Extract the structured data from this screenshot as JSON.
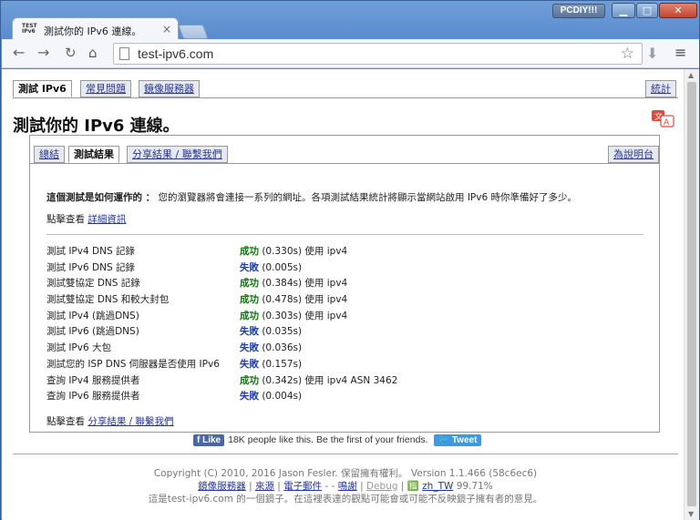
{
  "window": {
    "profile_label": "PCDIY!!!",
    "minimize_glyph": "▁",
    "maximize_glyph": "□",
    "close_glyph": "✕"
  },
  "browser": {
    "tab_title": "測試你的 IPv6 連線。",
    "tab_favicon_text": "TEST IPv6",
    "tab_close": "×",
    "url": "test-ipv6.com",
    "icons": {
      "back": "arrow-left-icon",
      "forward": "arrow-right-icon",
      "reload": "reload-icon",
      "home": "home-icon",
      "star": "star-icon",
      "download": "download-icon",
      "menu": "hamburger-menu-icon"
    }
  },
  "page": {
    "top_tabs": [
      "測試 IPv6",
      "常見問題",
      "鏡像服務器"
    ],
    "stats_tab": "統計",
    "title": "測試你的 IPv6 連線。",
    "inner_tabs": [
      "總結",
      "測試結果",
      "分享結果 / 聯繫我們"
    ],
    "help_tab": "為說明台",
    "intro_bold": "這個測試是如何運作的 ：",
    "intro_text": " 您的瀏覽器將會連接一系列的網址。各項測試結果統計將顯示當網站啟用 IPv6 時你準備好了多少。",
    "detail_prefix": "點擊查看 ",
    "detail_link": "詳細資訊",
    "results": [
      {
        "label": "測試 IPv4 DNS 記錄",
        "status": "成功",
        "detail": " (0.330s) 使用 ipv4",
        "ok": true
      },
      {
        "label": "測試 IPv6 DNS 記錄",
        "status": "失敗",
        "detail": " (0.005s)",
        "ok": false
      },
      {
        "label": "測試雙協定 DNS 記錄",
        "status": "成功",
        "detail": " (0.384s) 使用 ipv4",
        "ok": true
      },
      {
        "label": "測試雙協定 DNS 和較大封包",
        "status": "成功",
        "detail": " (0.478s) 使用 ipv4",
        "ok": true
      },
      {
        "label": "測試 IPv4 (跳過DNS)",
        "status": "成功",
        "detail": " (0.303s) 使用 ipv4",
        "ok": true
      },
      {
        "label": "測試 IPv6 (跳過DNS)",
        "status": "失敗",
        "detail": " (0.035s)",
        "ok": false
      },
      {
        "label": "測試 IPv6 大包",
        "status": "失敗",
        "detail": " (0.036s)",
        "ok": false
      },
      {
        "label": "測試您的 ISP DNS 伺服器是否使用 IPv6",
        "status": "失敗",
        "detail": " (0.157s)",
        "ok": false
      },
      {
        "label": "查詢 IPv4 服務提供者",
        "status": "成功",
        "detail": " (0.342s) 使用 ipv4 ASN 3462",
        "ok": true
      },
      {
        "label": "查詢 IPv6 服務提供者",
        "status": "失敗",
        "detail": " (0.004s)",
        "ok": false
      }
    ],
    "share_prefix": "點擊查看 ",
    "share_link": "分享結果 / 聯繫我們",
    "fb_like": "Like",
    "fb_text": "18K people like this. Be the first of your friends.",
    "tweet": "Tweet",
    "footer_copyright": "Copyright (C) 2010, 2016 Jason Fesler. 保留擁有權利。 Version 1.1.466 (58c6ec6)",
    "footer_links": {
      "mirrors": "鏡像服務器",
      "source": "來源",
      "email": "電子郵件",
      "dash1": " -  - ",
      "thanks": "鳴謝",
      "debug": "Debug",
      "lang": "zh_TW",
      "lang_pct": " 99.71%"
    },
    "footer_mirror_note": "這是test-ipv6.com 的一個鏡子。在這裡表達的觀點可能會或可能不反映鏡子擁有者的意見。"
  },
  "colors": {
    "success": "#0a7a0a",
    "failure": "#1a3dbb",
    "link": "#2233aa"
  }
}
